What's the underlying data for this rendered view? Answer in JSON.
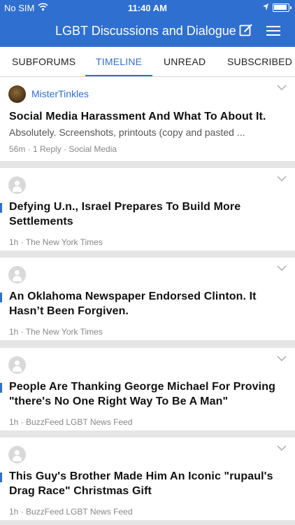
{
  "status_bar": {
    "carrier": "No SIM",
    "time": "11:40 AM"
  },
  "nav": {
    "title": "LGBT Discussions and Dialogue"
  },
  "tabs": [
    {
      "label": "SUBFORUMS"
    },
    {
      "label": "TIMELINE"
    },
    {
      "label": "UNREAD"
    },
    {
      "label": "SUBSCRIBED"
    }
  ],
  "active_tab": "TIMELINE",
  "posts": [
    {
      "author": "MisterTinkles",
      "title": "Social Media Harassment And What To About It.",
      "snippet": "Absolutely.  Screenshots, printouts (copy and pasted ...",
      "meta": "56m · 1 Reply · Social Media"
    },
    {
      "title": "Defying U.n., Israel Prepares To Build More Settlements",
      "meta": "1h · The New York Times"
    },
    {
      "title": "An Oklahoma Newspaper Endorsed Clinton. It Hasn’t Been Forgiven.",
      "meta": "1h · The New York Times"
    },
    {
      "title": "People Are Thanking George Michael For Proving \"there's No One Right Way To Be A Man\"",
      "meta": "1h · BuzzFeed LGBT News Feed"
    },
    {
      "title": "This Guy's Brother Made Him An Iconic \"rupaul's Drag Race\" Christmas Gift",
      "meta": "1h · BuzzFeed LGBT News Feed"
    }
  ],
  "colors": {
    "accent": "#2f6fd0"
  }
}
